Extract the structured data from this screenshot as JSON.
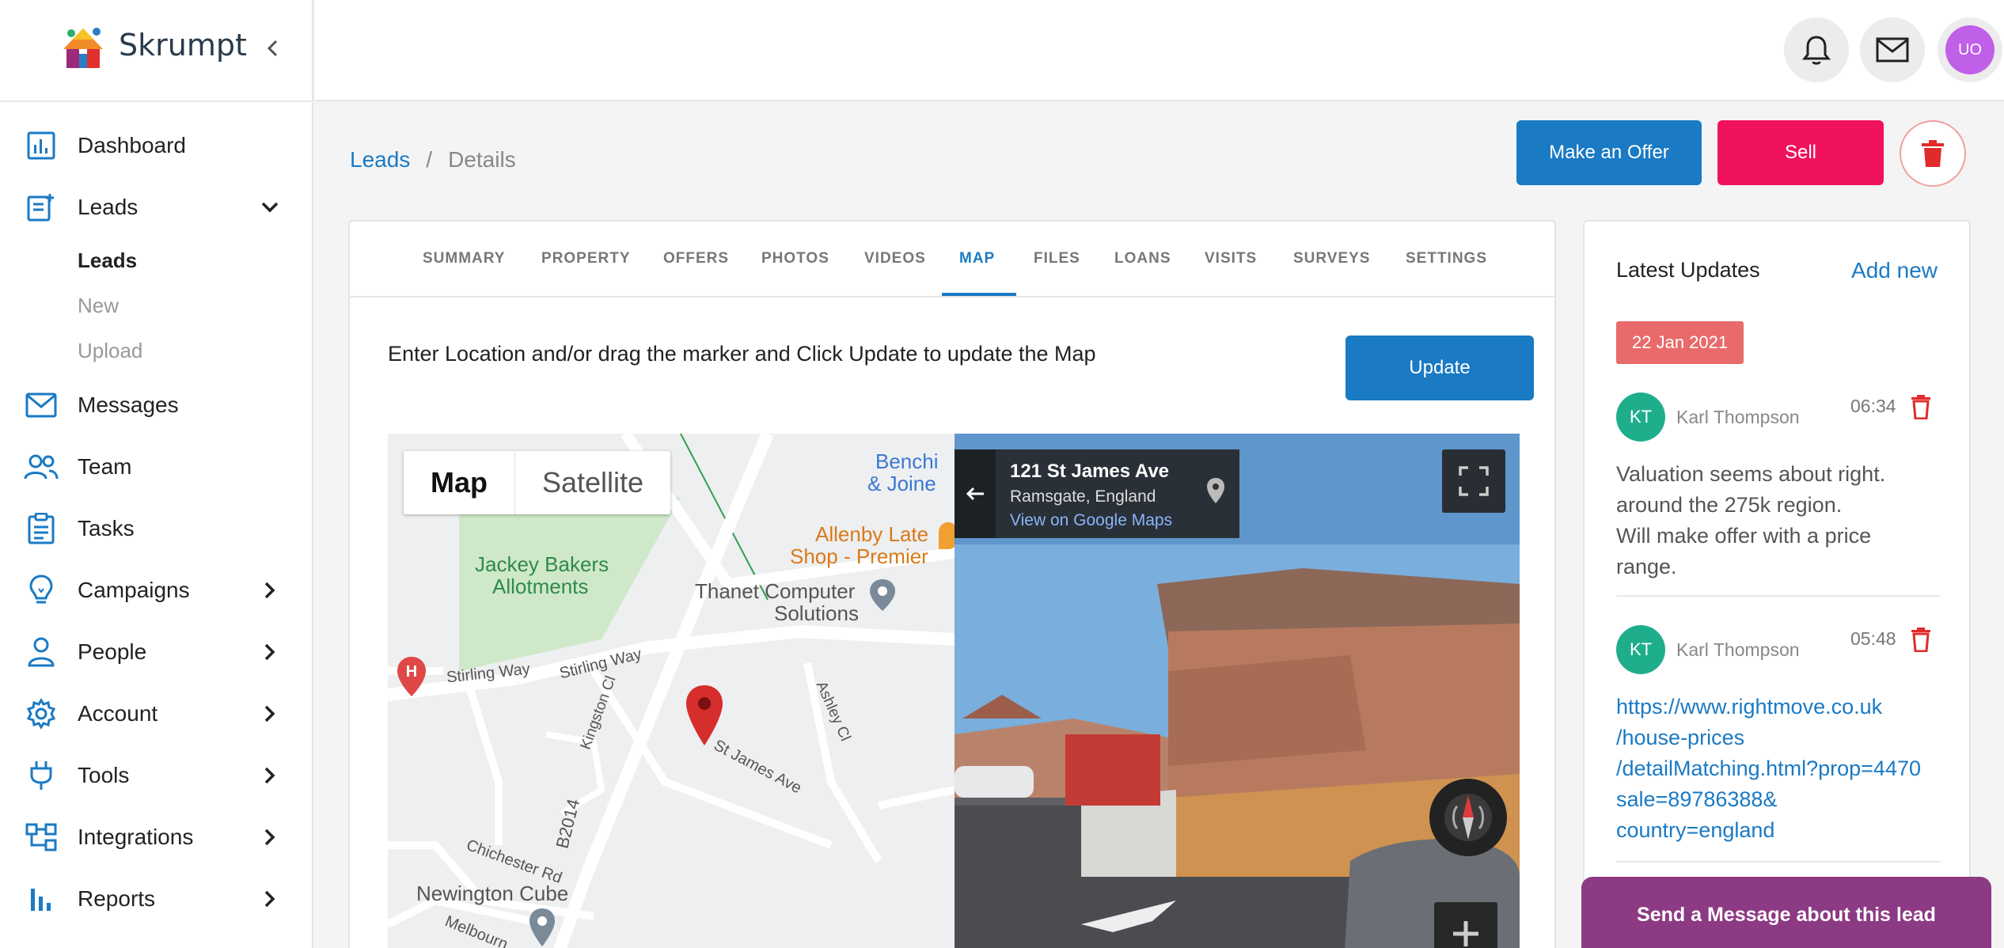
{
  "app": {
    "name": "Skrumpt"
  },
  "sidebar": {
    "items": [
      {
        "label": "Dashboard",
        "icon": "dashboard-icon"
      },
      {
        "label": "Leads",
        "icon": "leads-icon",
        "expanded": true
      },
      {
        "label": "Messages",
        "icon": "mail-icon"
      },
      {
        "label": "Team",
        "icon": "team-icon"
      },
      {
        "label": "Tasks",
        "icon": "clipboard-icon"
      },
      {
        "label": "Campaigns",
        "icon": "lightbulb-icon"
      },
      {
        "label": "People",
        "icon": "person-icon"
      },
      {
        "label": "Account",
        "icon": "gear-icon"
      },
      {
        "label": "Tools",
        "icon": "plug-icon"
      },
      {
        "label": "Integrations",
        "icon": "integrations-icon"
      },
      {
        "label": "Reports",
        "icon": "bar-chart-icon"
      }
    ],
    "leads_sub": [
      {
        "label": "Leads",
        "active": true
      },
      {
        "label": "New",
        "active": false
      },
      {
        "label": "Upload",
        "active": false
      }
    ]
  },
  "header": {
    "avatar_initials": "UO"
  },
  "breadcrumb": {
    "parent": "Leads",
    "separator": "/",
    "current": "Details"
  },
  "actions": {
    "offer": "Make an Offer",
    "sell": "Sell"
  },
  "tabs": [
    {
      "label": "SUMMARY"
    },
    {
      "label": "PROPERTY"
    },
    {
      "label": "OFFERS"
    },
    {
      "label": "PHOTOS"
    },
    {
      "label": "VIDEOS"
    },
    {
      "label": "MAP",
      "active": true
    },
    {
      "label": "FILES"
    },
    {
      "label": "LOANS"
    },
    {
      "label": "VISITS"
    },
    {
      "label": "SURVEYS"
    },
    {
      "label": "SETTINGS"
    }
  ],
  "map_panel": {
    "instruction": "Enter Location and/or drag the marker and Click Update to update the Map",
    "update_label": "Update",
    "map_type": {
      "map": "Map",
      "satellite": "Satellite"
    },
    "labels": {
      "bench": "Benchi",
      "joiners": "& Joine",
      "allenby1": "Allenby Late",
      "allenby2": "Shop - Premier",
      "jackey1": "Jackey Bakers",
      "jackey2": "Allotments",
      "thanet1": "Thanet Computer",
      "thanet2": "Solutions",
      "stirling1": "Stirling Way",
      "stirling2": "Stirling Way",
      "kingston": "Kingston Cl",
      "ashley": "Ashley Cl",
      "stjames": "St James Ave",
      "b2014": "B2014",
      "chichester": "Chichester Rd",
      "newington": "Newington Cube",
      "melbourne": "Melbourn"
    },
    "streetview": {
      "address": "121 St James Ave",
      "locality": "Ramsgate, England",
      "link": "View on Google Maps"
    }
  },
  "updates": {
    "title": "Latest Updates",
    "add_new": "Add new",
    "date": "22 Jan 2021",
    "entries": [
      {
        "initials": "KT",
        "author": "Karl Thompson",
        "time": "06:34",
        "lines": [
          "Valuation seems about right.",
          "around the 275k region.",
          "Will make offer with a price",
          "range."
        ]
      },
      {
        "initials": "KT",
        "author": "Karl Thompson",
        "time": "05:48",
        "lines": [
          "https://www.rightmove.co.uk",
          "/house-prices",
          "/detailMatching.html?prop=4470",
          "sale=89786388&",
          "country=england"
        ]
      }
    ]
  },
  "send_message": "Send a Message about this lead",
  "colors": {
    "primary": "#1a7ac4",
    "sell": "#f0125f",
    "delete": "#e12a2a",
    "send": "#8c3a84",
    "badge": "#e96a6a",
    "avatar": "#1fae8c"
  }
}
